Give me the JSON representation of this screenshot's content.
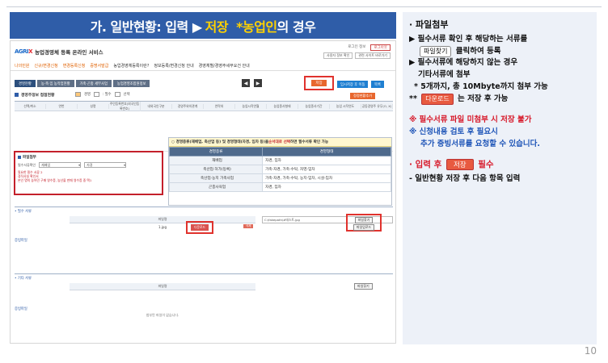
{
  "slide": {
    "title_prefix": "가. 일반현황: 입력 ▶",
    "title_highlight": "저장",
    "title_suffix_hl": "*농업인",
    "title_suffix": "의 경우",
    "page_number": "10"
  },
  "screen": {
    "logo_mark": "AGRI",
    "logo_mark_x": "X",
    "service_name": "농업경영체 등록 온라인 서비스",
    "util": {
      "user": "로그인 정보",
      "logout": "로그아웃",
      "my_info": "사용자 정보 확인",
      "site": "관련 사이트 바로가기"
    },
    "gnb": [
      "나의민원",
      "신규/변경신청",
      "변경등록신청",
      "증명서발급",
      "농업경영체등록이란?",
      "정보등록/변경신청 안내",
      "경영체별/경영주세부요건 안내"
    ],
    "tabs": [
      "경영현황",
      "농·축·임 농작업현황",
      "가축·곤충 세부사업",
      "농업경영조합원정보"
    ],
    "save_label": "저장",
    "temp_save_label": "임시저장 후 이동",
    "print_label": "목록",
    "section_title": "경영주정보 접점현황",
    "legend": [
      "경영",
      ": 필수",
      "선택"
    ],
    "add_label": "정정현황추가",
    "grid_headers": [
      "선택/취소",
      "연번",
      "성명",
      "주민등록번호(외국인등록번호)",
      "내외국인구분",
      "경영주와의관계",
      "연락처",
      "농업시작연월",
      "농업종사형태",
      "농업종사기간",
      "농업 시작연도",
      "공동경영주 유무(O, X)"
    ],
    "attach": {
      "title": "파일첨부",
      "label1": "필수서류확인",
      "select1": "재배업",
      "select2": "자경",
      "note1": "필요한 필수 서류 2",
      "note2": "경작사실 확인서",
      "note3": "본인 명의 농어민 구매 영수증, 농산물 판매 영수증 중 택1"
    },
    "popup": {
      "title_prefix": "○ 경영종류(재배업, 축산업 등) 및 경영형태(자경, 임차 등)을 ",
      "title_emph": "순서대로 선택",
      "title_suffix": "하면 필수서류 확인 가능",
      "col_type": "경영종류",
      "col_form": "경영형태",
      "rows": [
        {
          "type": "재배업",
          "form": "자경, 임차"
        },
        {
          "type": "축산업·허가(등록)",
          "form": "가축-자경, 가축-수탁, 자영-임차"
        },
        {
          "type": "축산업·농지 가축사업",
          "form": "가축-자경, 가축-수탁, 농지-임차, 시설-임차"
        },
        {
          "type": "곤충사육업",
          "form": "자경, 임차"
        }
      ]
    },
    "required": {
      "label": "• 필수 서류",
      "proof_label": "증빙파일",
      "col_file": "파일명",
      "file_name": "1.jpg",
      "download": "다운로드",
      "delete": "삭제",
      "attached_path": "C:\\fakepath\\#테스트.jpg",
      "find_file": "파일찾기",
      "find_file2": "파일업로드"
    },
    "other": {
      "label": "• 기타 서류",
      "proof_label": "증빙파일",
      "col_file": "파일명",
      "find_file": "파일찾기",
      "empty": "첨부된 파일이 없습니다."
    }
  },
  "panel": {
    "head": "· 파일첨부",
    "l1": "▶ 필수서류 확인 후 해당하는 서류를",
    "l2_chip": "파일찾기",
    "l2_text": "클릭하여 등록",
    "l3": "▶ 필수서류에 해당하지 않는 경우",
    "l4": "기타서류에 첨부",
    "l5": "* 5개까지, 총 10Mbyte까지 첨부 가능",
    "l6_prefix": "**",
    "l6_chip": "다운로드",
    "l6_text": "는 저장 후 가능",
    "warn": "※ 필수서류 파일 미첨부 시 저장 불가",
    "info1": "※ 신청내용 검토 후 필요시",
    "info2": "추가 증빙서류를 요청할 수 있습니다.",
    "input_prefix": "· 입력 후",
    "input_chip": "저장",
    "input_suffix": "필수",
    "final": "- 일반현황 저장 후 다음 항목 입력"
  }
}
